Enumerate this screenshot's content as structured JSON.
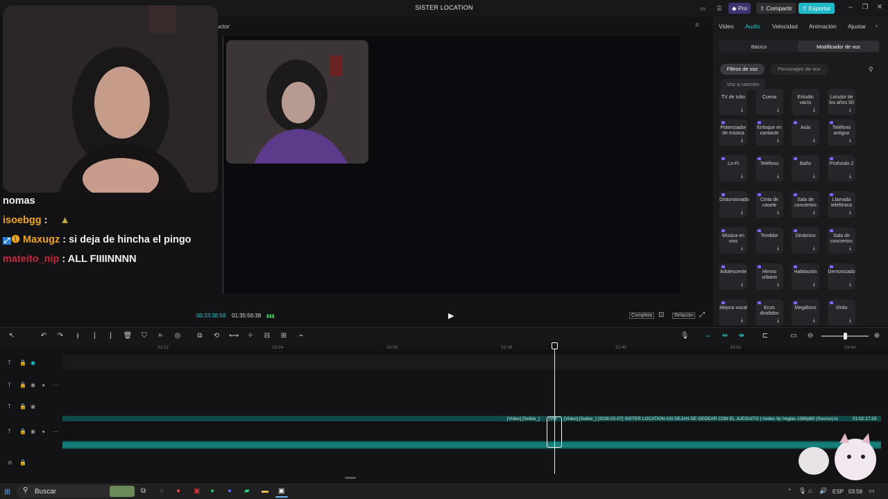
{
  "app": {
    "title": "SISTER LOCATION"
  },
  "titlebar": {
    "pro": "Pro",
    "share": "Compartir",
    "export": "Exportar"
  },
  "player": {
    "header_fragment": "uctor",
    "time_current": "00:33:38:58",
    "time_total": "01:35:56:38",
    "full": "Completa",
    "ratio": "Relación"
  },
  "chat": [
    {
      "user": "",
      "text": "nomas",
      "color": "#f2f2f2"
    },
    {
      "user": "isoebgg",
      "text": ":",
      "color": "#f0a51f"
    },
    {
      "user": "Maxugz",
      "text": ": si deja de hincha el pingo",
      "color": "#f0a51f"
    },
    {
      "user": "mateito_nip",
      "text": ": ALL FIIIINNNN",
      "color": "#c3283b"
    }
  ],
  "panel": {
    "tabs": [
      "Video",
      "Audio",
      "Velocidad",
      "Animación",
      "Ajustar"
    ],
    "active_tab": "Audio",
    "subtabs": [
      "Básico",
      "Modificador de voz"
    ],
    "filters": [
      "Filtros de voz",
      "Personajes de voz"
    ],
    "voice_to_song": "Voz a canción",
    "effects": [
      "TV de tubo",
      "Cueva",
      "Estudio vacío",
      "Locutor de los años 50",
      "Potenciador de música",
      "Enfoque en cantante",
      "Aula",
      "Teléfono antiguo",
      "Lo-Fi",
      "Teléfono",
      "Baño",
      "Profundo 2",
      "Distorsionado",
      "Cinta de casete",
      "Sala de conciertos",
      "Llamada telefónica",
      "Música en vivo",
      "Temblor",
      "Dinámico",
      "Sala de conciertos",
      "Adolescente",
      "Himno urbano",
      "Habitación",
      "Demonizado",
      "Mejora vocal",
      "Ecos divididos",
      "Megáfono",
      "Vinilo"
    ]
  },
  "timeline": {
    "ticks": [
      "33:32",
      "33:34",
      "33:36",
      "33:38",
      "33:40",
      "33:42",
      "33:44"
    ],
    "clip_small_1": "[Video] [Seikie_]",
    "clip_small_2": "[Vid",
    "clip_label": "[Video] [Seikie_] [2026-02-07] SISTER LOCATION ASI DEJAN DE GEDEAR CON EL JUEGUITO  |  !redes !ip !reglas 1080p60 (Source).ts",
    "clip_duration": "01:02:17:33"
  },
  "taskbar": {
    "search": "Buscar",
    "lang": "ESP",
    "time": "03:58"
  },
  "colors": {
    "accent": "#1fc9c9",
    "pro": "#5b4de0",
    "export": "#1fb8c9",
    "clip": "#0f4a48"
  }
}
